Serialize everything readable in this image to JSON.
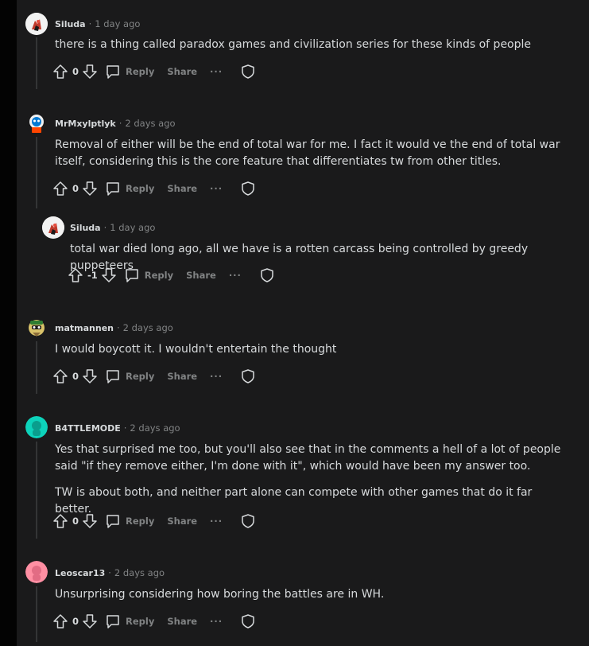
{
  "labels": {
    "reply": "Reply",
    "share": "Share",
    "more": "···"
  },
  "comments": [
    {
      "author": "Siluda",
      "time": "1 day ago",
      "paragraphs": [
        "there is a thing called paradox games and civilization series for these kinds of people"
      ],
      "votes": "0",
      "avatar_color": "#ffffff"
    },
    {
      "author": "MrMxylptlyk",
      "time": "2 days ago",
      "paragraphs": [
        "Removal of either will be the end of total war for me. I fact it would ve the end of total war itself, considering this is the core feature that differentiates tw from other titles."
      ],
      "votes": "0",
      "avatar_color": "#0dd3bb"
    },
    {
      "author": "Siluda",
      "time": "1 day ago",
      "paragraphs": [
        "total war died long ago, all we have is a rotten carcass being controlled by greedy puppeteers"
      ],
      "votes": "-1",
      "avatar_color": "#ffffff"
    },
    {
      "author": "matmannen",
      "time": "2 days ago",
      "paragraphs": [
        "I would boycott it. I wouldn't entertain the thought"
      ],
      "votes": "0",
      "avatar_color": "#b8a44a"
    },
    {
      "author": "B4TTLEMODE",
      "time": "2 days ago",
      "paragraphs": [
        "Yes that surprised me too, but you'll also see that in the comments a hell of a lot of people said \"if they remove either, I'm done with it\", which would have been my answer too.",
        "TW is about both, and neither part alone can compete with other games that do it far better."
      ],
      "votes": "0",
      "avatar_color": "#0dd3bb"
    },
    {
      "author": "Leoscar13",
      "time": "2 days ago",
      "paragraphs": [
        "Unsurprising considering how boring the battles are in WH."
      ],
      "votes": "0",
      "avatar_color": "#ff8fa3"
    }
  ]
}
